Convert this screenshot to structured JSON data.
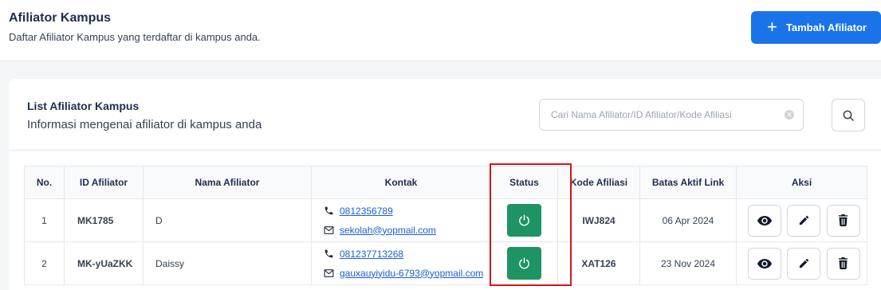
{
  "header": {
    "title": "Afiliator Kampus",
    "subtitle": "Daftar Afiliator Kampus yang terdaftar di kampus anda.",
    "add_button_label": "Tambah Afiliator"
  },
  "card": {
    "title": "List Afiliator Kampus",
    "subtitle": "Informasi mengenai afiliator di kampus anda",
    "search_placeholder": "Cari Nama Afiliator/ID Afiliator/Kode Afiliasi",
    "search_value": ""
  },
  "table": {
    "headers": {
      "no": "No.",
      "id": "ID Afiliator",
      "name": "Nama Afiliator",
      "contact": "Kontak",
      "status": "Status",
      "code": "Kode Afiliasi",
      "expiry": "Batas Aktif Link",
      "actions": "Aksi"
    },
    "rows": [
      {
        "no": "1",
        "id": "MK1785",
        "name": "D",
        "phone": "0812356789",
        "email": "sekolah@yopmail.com",
        "code": "IWJ824",
        "expiry": "06 Apr 2024"
      },
      {
        "no": "2",
        "id": "MK-yUaZKK",
        "name": "Daissy",
        "phone": "081237713268",
        "email": "gauxauyiyidu-6793@yopmail.com",
        "code": "XAT126",
        "expiry": "23 Nov 2024"
      }
    ]
  },
  "icons": {
    "add": "plus-icon",
    "search": "search-icon",
    "clear": "clear-icon",
    "phone": "phone-icon",
    "email": "mail-icon",
    "status": "power-icon",
    "view": "eye-icon",
    "edit": "pencil-icon",
    "delete": "trash-icon"
  },
  "colors": {
    "primary": "#1a73e8",
    "status_active": "#1e9464",
    "highlight": "#d41616",
    "link": "#1a5fd0"
  }
}
